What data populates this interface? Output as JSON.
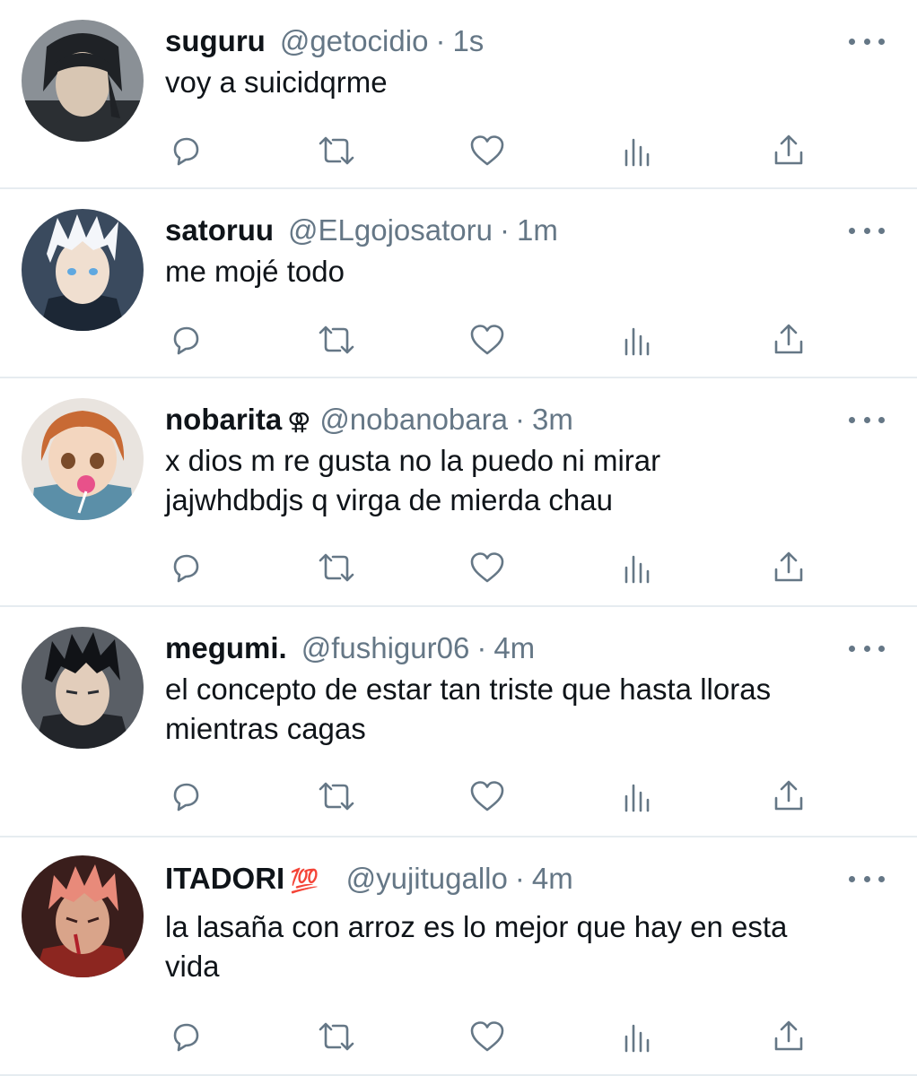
{
  "colors": {
    "text": "#0f1419",
    "secondary": "#657786",
    "divider": "#e6ecf0",
    "badge": "#e0245e"
  },
  "tweets": [
    {
      "name": "suguru",
      "badge": "",
      "handle": "@getocidio",
      "separator": "·",
      "time": "1s",
      "lines": [
        "voy a suicidqrme"
      ],
      "actions": [
        "reply-icon",
        "retweet-icon",
        "like-icon",
        "analytics-icon",
        "share-icon"
      ]
    },
    {
      "name": "satoruu",
      "badge": "",
      "handle": "@ELgojosatoru",
      "separator": "·",
      "time": "1m",
      "lines": [
        "me mojé todo"
      ],
      "actions": [
        "reply-icon",
        "retweet-icon",
        "like-icon",
        "analytics-icon",
        "share-icon"
      ]
    },
    {
      "name": "nobarita",
      "badge": "⚢",
      "handle": "@nobanobara",
      "separator": "·",
      "time": "3m",
      "lines": [
        "x dios m re gusta no la puedo ni mirar",
        "jajwhdbdjs q virga de mierda chau"
      ],
      "actions": [
        "reply-icon",
        "retweet-icon",
        "like-icon",
        "analytics-icon",
        "share-icon"
      ]
    },
    {
      "name": "megumi.",
      "badge": "",
      "handle": "@fushigur06",
      "separator": "·",
      "time": "4m",
      "lines": [
        "el concepto de estar tan triste que hasta lloras",
        "mientras cagas"
      ],
      "actions": [
        "reply-icon",
        "retweet-icon",
        "like-icon",
        "analytics-icon",
        "share-icon"
      ]
    },
    {
      "name": "ITADORI",
      "badge": "💯",
      "handle": "@yujitugallo",
      "separator": "·",
      "time": "4m",
      "lines": [
        "la lasaña con arroz es lo mejor que hay en esta",
        "vida"
      ],
      "actions": [
        "reply-icon",
        "retweet-icon",
        "like-icon",
        "analytics-icon",
        "share-icon"
      ]
    }
  ]
}
